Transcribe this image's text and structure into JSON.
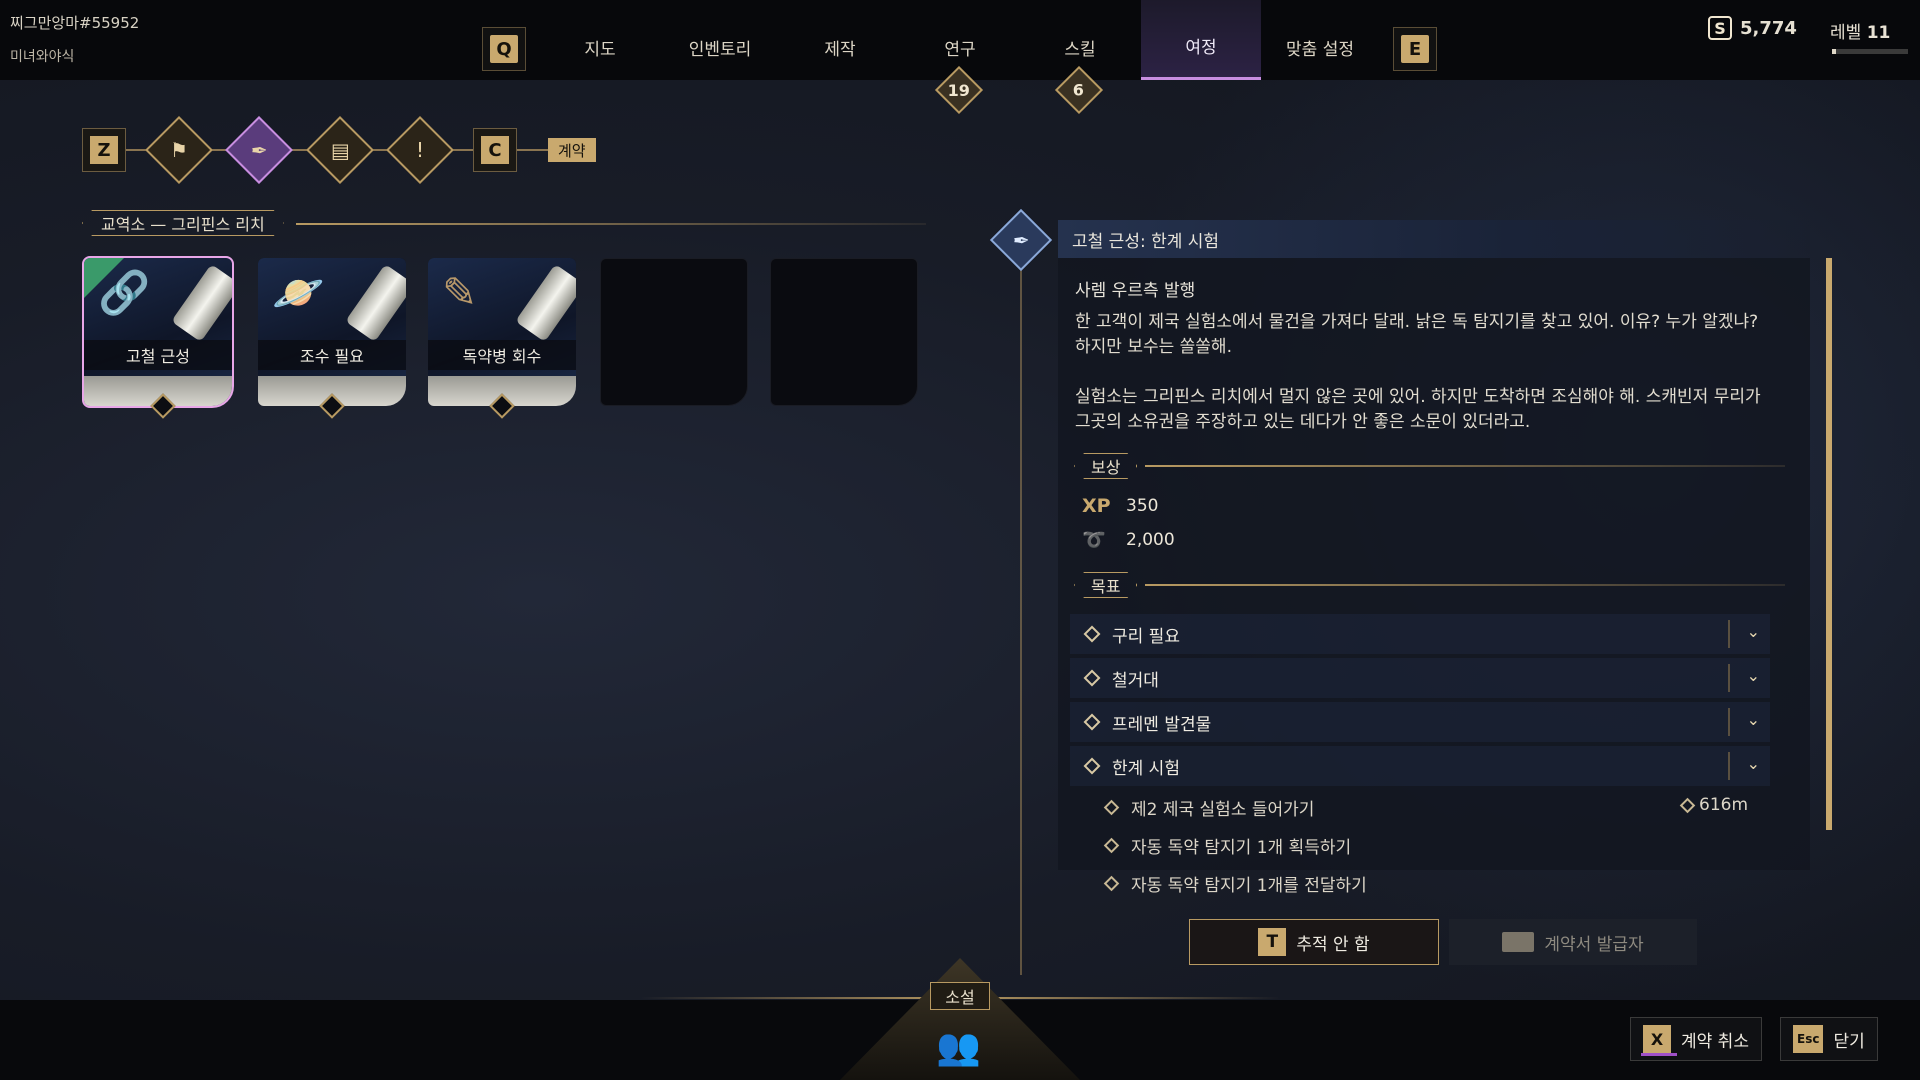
{
  "player": {
    "name": "찌그만앙마#55952",
    "title": "미녀와야식"
  },
  "nav": {
    "left_key": "Q",
    "right_key": "E",
    "tabs": [
      {
        "label": "지도"
      },
      {
        "label": "인벤토리"
      },
      {
        "label": "제작"
      },
      {
        "label": "연구",
        "badge": "19"
      },
      {
        "label": "스킬",
        "badge": "6"
      },
      {
        "label": "여정",
        "active": true
      },
      {
        "label": "맞춤 설정"
      }
    ]
  },
  "currency": {
    "symbol": "S",
    "amount": "5,774"
  },
  "level": {
    "label": "레벨",
    "value": "11",
    "progress": 0.05
  },
  "breadcrumb": {
    "left_key": "Z",
    "right_key": "C",
    "current_label": "계약"
  },
  "section": {
    "title": "교역소 — 그리핀스 리치"
  },
  "contracts": [
    {
      "label": "고철 근성",
      "icon": "chain-icon",
      "selected": true,
      "tracked": true
    },
    {
      "label": "조수 필요",
      "icon": "planet-icon"
    },
    {
      "label": "독약병 회수",
      "icon": "note-icon"
    }
  ],
  "detail": {
    "title": "고철 근성: 한계 시험",
    "issuer": "사렘 우르측 발행",
    "paragraphs": [
      "한 고객이 제국 실험소에서 물건을 가져다 달래. 낡은 독 탐지기를 찾고 있어. 이유? 누가 알겠냐? 하지만 보수는 쏠쏠해.",
      "실험소는 그리핀스 리치에서 멀지 않은 곳에 있어. 하지만 도착하면 조심해야 해. 스캐빈저 무리가 그곳의 소유권을 주장하고 있는 데다가 안 좋은 소문이 있더라고."
    ],
    "rewards_label": "보상",
    "rewards": [
      {
        "icon": "xp-icon",
        "icon_text": "XP",
        "value": "350"
      },
      {
        "icon": "scrap-icon",
        "icon_text": "",
        "value": "2,000"
      }
    ],
    "objectives_label": "목표",
    "objectives": [
      {
        "label": "구리 필요",
        "completed": true
      },
      {
        "label": "철거대",
        "completed": true
      },
      {
        "label": "프레멘 발견물",
        "completed": true
      },
      {
        "label": "한계 시험",
        "completed": false
      }
    ],
    "tasks": [
      {
        "label": "제2 제국 실험소 들어가기",
        "distance": "616m"
      },
      {
        "label": "자동 독약 탐지기 1개 획득하기"
      },
      {
        "label": "자동 독약 탐지기 1개를 전달하기"
      }
    ],
    "track_button": {
      "key": "T",
      "label": "추적 안 함"
    },
    "issuer_button": {
      "label": "계약서 발급자"
    }
  },
  "bottom": {
    "novel_label": "소설",
    "cancel": {
      "key": "X",
      "label": "계약 취소"
    },
    "close": {
      "key": "Esc",
      "label": "닫기"
    }
  }
}
